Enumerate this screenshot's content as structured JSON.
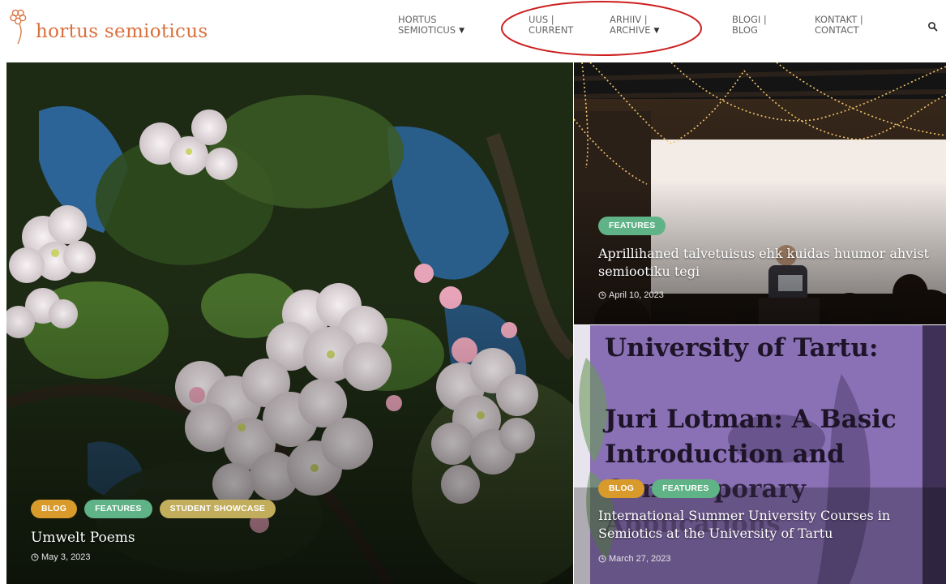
{
  "site": {
    "logo_text": "hortus semioticus",
    "brand_color": "#d9703d"
  },
  "nav": {
    "items": [
      {
        "line1": "HORTUS",
        "line2": "SEMIOTICUS",
        "dropdown": true
      },
      {
        "line1": "UUS |",
        "line2": "CURRENT",
        "dropdown": false
      },
      {
        "line1": "ARHIIV |",
        "line2": "ARCHIVE",
        "dropdown": true
      },
      {
        "line1": "BLOGI |",
        "line2": "BLOG",
        "dropdown": false
      },
      {
        "line1": "KONTAKT |",
        "line2": "CONTACT",
        "dropdown": false
      }
    ],
    "search_icon": "search-icon"
  },
  "colors": {
    "tag_blog": "#d89a2b",
    "tag_features": "#5fb386",
    "tag_student_showcase": "#c2ad5c",
    "annotation": "#cc1f1f"
  },
  "posts": {
    "featured": {
      "tags": [
        "BLOG",
        "FEATURES",
        "STUDENT SHOWCASE"
      ],
      "title": "Umwelt Poems",
      "date": "May 3, 2023"
    },
    "top_right": {
      "tags": [
        "FEATURES"
      ],
      "title": "Aprillihaned talvetuisus ehk kuidas huumor ahvist semiootiku tegi",
      "date": "April 10, 2023"
    },
    "bottom_right": {
      "tags": [
        "BLOG",
        "FEATURES"
      ],
      "title": "International Summer University Courses in Semiotics at the University of Tartu",
      "date": "March 27, 2023",
      "poster_lines": [
        "University of Tartu:",
        "Juri Lotman: A Basic",
        "Introduction and",
        "Contemporary",
        "Applications"
      ]
    }
  }
}
